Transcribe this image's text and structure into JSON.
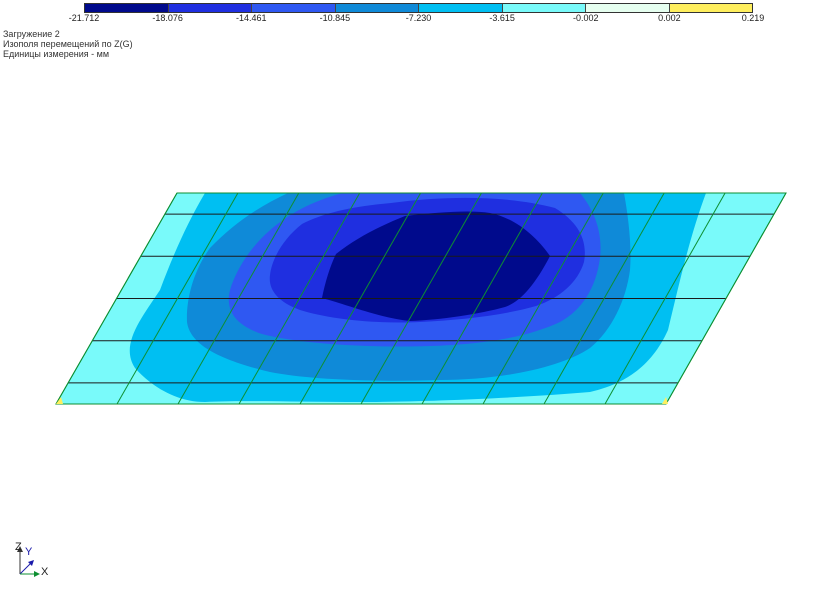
{
  "legend": {
    "ticks": [
      "-21.712",
      "-18.076",
      "-14.461",
      "-10.845",
      "-7.230",
      "-3.615",
      "-0.002",
      "0.002",
      "0.219"
    ],
    "colors": [
      "#000a8c",
      "#1f2fe0",
      "#2f58f2",
      "#0f8ad8",
      "#00bff2",
      "#79fafa",
      "#e6fff0",
      "#ffef5e"
    ]
  },
  "info": {
    "line1": "Загружение  2",
    "line2": "Изополя  перемещений по Z(G)",
    "line3": "Единицы измерения - мм"
  },
  "plot": {
    "edge_color": "#0d8f32",
    "grid_color": "#1a1a1a",
    "bands": [
      "#79fafa",
      "#00bff2",
      "#0f8ad8",
      "#2f58f2",
      "#1f2fe0",
      "#000a8c"
    ]
  },
  "axes": {
    "z": "Z",
    "y": "Y",
    "x": "X"
  }
}
